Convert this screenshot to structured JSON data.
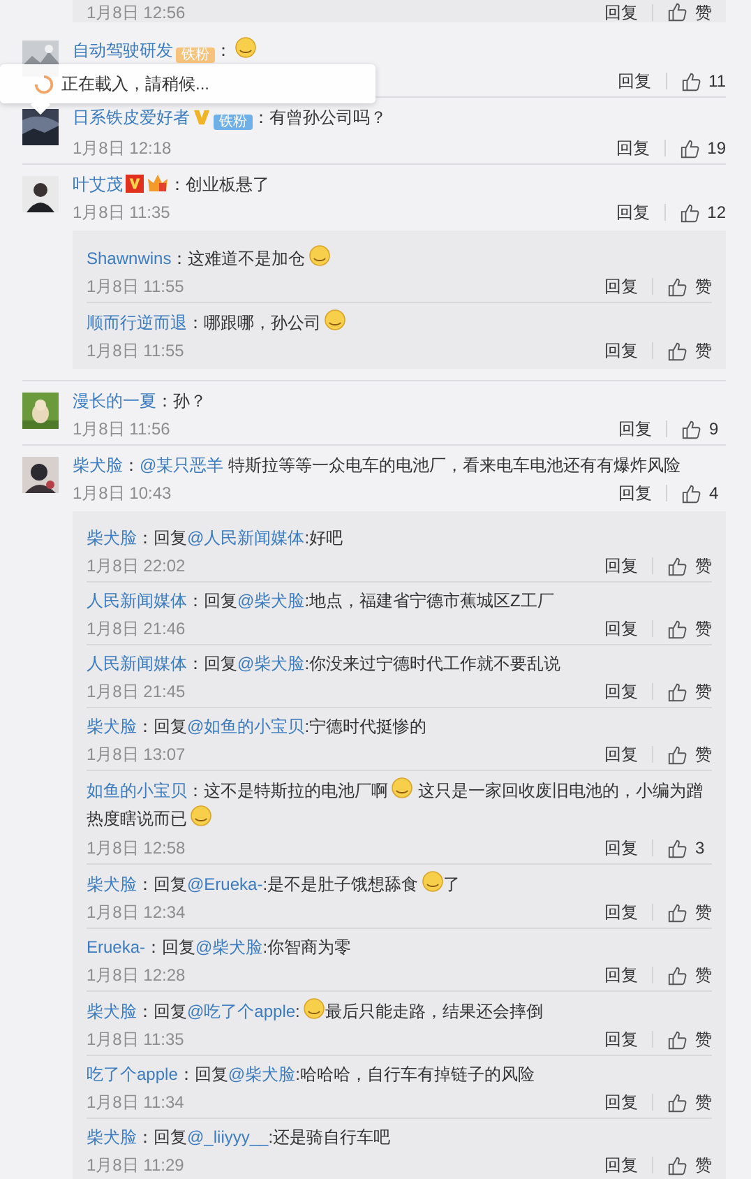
{
  "top_reply_fragment": {
    "time": "1月8日 12:56",
    "reply_label": "回复",
    "likes": "赞"
  },
  "loading_tooltip": {
    "text": "正在載入，請稍候..."
  },
  "comments": [
    {
      "avatar": {
        "kind": "picture"
      },
      "name": "自动驾驶研发",
      "badges": [
        {
          "kind": "fan",
          "text": "铁粉",
          "color": "#f7c27a"
        }
      ],
      "text": [
        {
          "kind": "text",
          "text": "："
        },
        {
          "kind": "emoji"
        }
      ],
      "reply_label": "回复",
      "likes": "11"
    },
    {
      "avatar": {
        "kind": "picture"
      },
      "name": "日系铁皮爱好者",
      "badges": [
        {
          "kind": "vip-gold"
        },
        {
          "kind": "fan",
          "text": "铁粉",
          "color": "#6fb0e8"
        }
      ],
      "text": [
        {
          "kind": "text",
          "text": "：有曾孙公司吗？"
        }
      ],
      "time": "1月8日 12:18",
      "reply_label": "回复",
      "likes": "19"
    },
    {
      "avatar": {
        "kind": "picture"
      },
      "name": "叶艾茂",
      "badges": [
        {
          "kind": "vip-red"
        },
        {
          "kind": "crown"
        }
      ],
      "text": [
        {
          "kind": "text",
          "text": "：创业板悬了"
        }
      ],
      "time": "1月8日 11:35",
      "reply_label": "回复",
      "likes": "12",
      "replies": [
        {
          "name": "Shawnwins",
          "text": [
            {
              "kind": "text",
              "text": "：这难道不是加仓"
            },
            {
              "kind": "emoji"
            }
          ],
          "time": "1月8日 11:55",
          "reply_label": "回复",
          "likes": "赞"
        },
        {
          "name": "顺而行逆而退",
          "text": [
            {
              "kind": "text",
              "text": "：哪跟哪，孙公司"
            },
            {
              "kind": "emoji"
            }
          ],
          "time": "1月8日 11:55",
          "reply_label": "回复",
          "likes": "赞"
        }
      ]
    },
    {
      "avatar": {
        "kind": "picture"
      },
      "name": "漫长的一夏",
      "text": [
        {
          "kind": "text",
          "text": "：孙？"
        }
      ],
      "time": "1月8日 11:56",
      "reply_label": "回复",
      "likes": "9"
    },
    {
      "avatar": {
        "kind": "picture"
      },
      "name": "柴犬脸",
      "text": [
        {
          "kind": "text",
          "text": "："
        },
        {
          "kind": "mention",
          "text": "@某只恶羊"
        },
        {
          "kind": "text",
          "text": " 特斯拉等等一众电车的电池厂，看来电车电池还有有爆炸风险"
        }
      ],
      "time": "1月8日 10:43",
      "reply_label": "回复",
      "likes": "4",
      "replies": [
        {
          "name": "柴犬脸",
          "text": [
            {
              "kind": "text",
              "text": "：回复"
            },
            {
              "kind": "mention",
              "text": "@人民新闻媒体"
            },
            {
              "kind": "text",
              "text": ":好吧"
            }
          ],
          "time": "1月8日 22:02",
          "reply_label": "回复",
          "likes": "赞"
        },
        {
          "name": "人民新闻媒体",
          "text": [
            {
              "kind": "text",
              "text": "：回复"
            },
            {
              "kind": "mention",
              "text": "@柴犬脸"
            },
            {
              "kind": "text",
              "text": ":地点，福建省宁德市蕉城区Z工厂"
            }
          ],
          "time": "1月8日 21:46",
          "reply_label": "回复",
          "likes": "赞"
        },
        {
          "name": "人民新闻媒体",
          "text": [
            {
              "kind": "text",
              "text": "：回复"
            },
            {
              "kind": "mention",
              "text": "@柴犬脸"
            },
            {
              "kind": "text",
              "text": ":你没来过宁德时代工作就不要乱说"
            }
          ],
          "time": "1月8日 21:45",
          "reply_label": "回复",
          "likes": "赞"
        },
        {
          "name": "柴犬脸",
          "text": [
            {
              "kind": "text",
              "text": "：回复"
            },
            {
              "kind": "mention",
              "text": "@如鱼的小宝贝"
            },
            {
              "kind": "text",
              "text": ":宁德时代挺惨的"
            }
          ],
          "time": "1月8日 13:07",
          "reply_label": "回复",
          "likes": "赞"
        },
        {
          "name": "如鱼的小宝贝",
          "text": [
            {
              "kind": "text",
              "text": "：这不是特斯拉的电池厂啊"
            },
            {
              "kind": "emoji"
            },
            {
              "kind": "text",
              "text": " 这只是一家回收废旧电池的，小编为蹭热度瞎说而已"
            },
            {
              "kind": "emoji"
            }
          ],
          "time": "1月8日 12:58",
          "reply_label": "回复",
          "likes": "3"
        },
        {
          "name": "柴犬脸",
          "text": [
            {
              "kind": "text",
              "text": "：回复"
            },
            {
              "kind": "mention",
              "text": "@Erueka-"
            },
            {
              "kind": "text",
              "text": ":是不是肚子饿想舔食"
            },
            {
              "kind": "emoji"
            },
            {
              "kind": "text",
              "text": "了"
            }
          ],
          "time": "1月8日 12:34",
          "reply_label": "回复",
          "likes": "赞"
        },
        {
          "name": "Erueka-",
          "text": [
            {
              "kind": "text",
              "text": "：回复"
            },
            {
              "kind": "mention",
              "text": "@柴犬脸"
            },
            {
              "kind": "text",
              "text": ":你智商为零"
            }
          ],
          "time": "1月8日 12:28",
          "reply_label": "回复",
          "likes": "赞"
        },
        {
          "name": "柴犬脸",
          "text": [
            {
              "kind": "text",
              "text": "：回复"
            },
            {
              "kind": "mention",
              "text": "@吃了个apple"
            },
            {
              "kind": "text",
              "text": ":"
            },
            {
              "kind": "emoji"
            },
            {
              "kind": "text",
              "text": "最后只能走路，结果还会摔倒"
            }
          ],
          "time": "1月8日 11:35",
          "reply_label": "回复",
          "likes": "赞"
        },
        {
          "name": "吃了个apple",
          "text": [
            {
              "kind": "text",
              "text": "：回复"
            },
            {
              "kind": "mention",
              "text": "@柴犬脸"
            },
            {
              "kind": "text",
              "text": ":哈哈哈，自行车有掉链子的风险"
            }
          ],
          "time": "1月8日 11:34",
          "reply_label": "回复",
          "likes": "赞"
        },
        {
          "name": "柴犬脸",
          "text": [
            {
              "kind": "text",
              "text": "：回复"
            },
            {
              "kind": "mention",
              "text": "@_liiyyy__"
            },
            {
              "kind": "text",
              "text": ":还是骑自行车吧"
            }
          ],
          "time": "1月8日 11:29",
          "reply_label": "回复",
          "likes": "赞"
        }
      ]
    }
  ]
}
